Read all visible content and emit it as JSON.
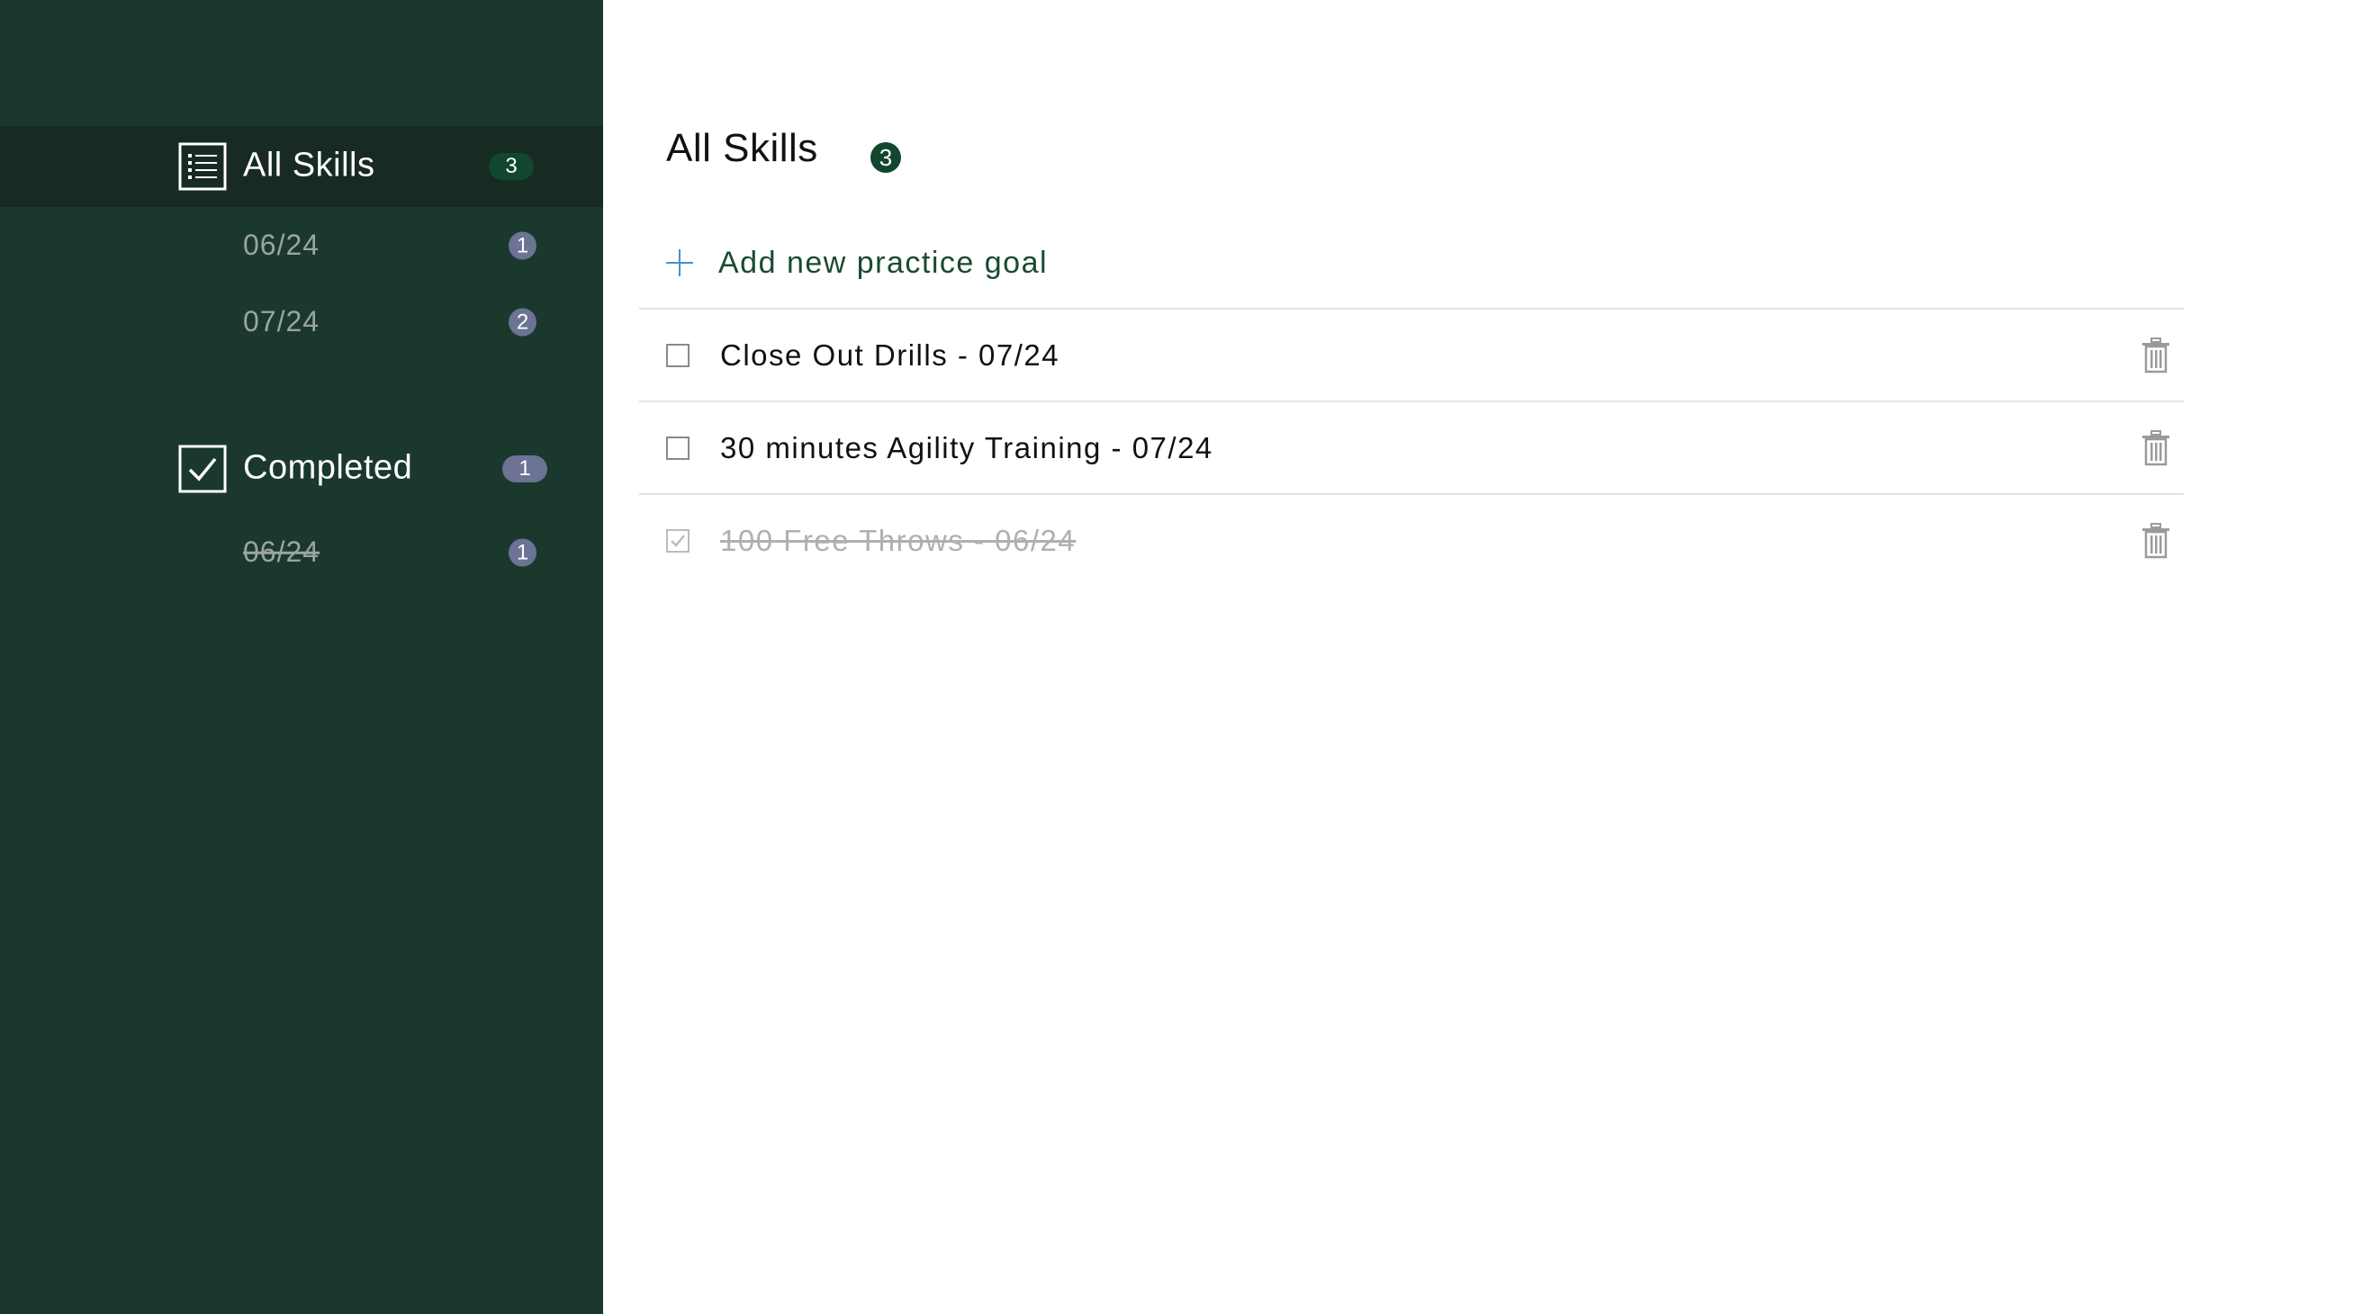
{
  "sidebar": {
    "all_skills": {
      "label": "All Skills",
      "count": "3",
      "icon": "list-icon",
      "items": [
        {
          "label": "06/24",
          "count": "1"
        },
        {
          "label": "07/24",
          "count": "2"
        }
      ]
    },
    "completed": {
      "label": "Completed",
      "count": "1",
      "icon": "checkbox-checked-icon",
      "items": [
        {
          "label": "06/24",
          "count": "1"
        }
      ]
    }
  },
  "main": {
    "title": "All Skills",
    "count": "3",
    "add_label": "Add new practice goal",
    "tasks": [
      {
        "text": "Close Out Drills - 07/24",
        "done": false
      },
      {
        "text": "30 minutes Agility Training - 07/24",
        "done": false
      },
      {
        "text": "100 Free Throws - 06/24",
        "done": true
      }
    ]
  },
  "colors": {
    "sidebar_bg": "#1a392c",
    "sidebar_active_bg": "#172b22",
    "accent_green": "#11472f",
    "badge_gray": "#6c7394",
    "plus_blue": "#4a8fc7"
  }
}
